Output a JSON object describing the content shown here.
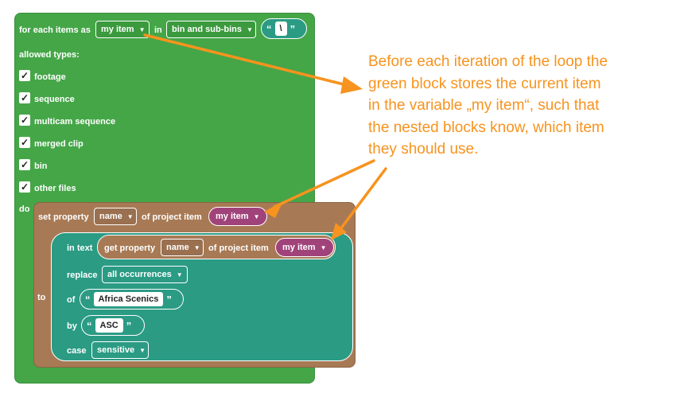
{
  "loop": {
    "label": "for each items as",
    "var": "my item",
    "in_label": "in",
    "scope": "bin and sub-bins",
    "separator": "\\",
    "allowed_label": "allowed types:",
    "types": [
      "footage",
      "sequence",
      "multicam sequence",
      "merged clip",
      "bin",
      "other files"
    ],
    "do_label": "do"
  },
  "set_property": {
    "label": "set property",
    "property": "name",
    "of_label": "of project item",
    "var": "my item",
    "to_label": "to"
  },
  "replace": {
    "in_text_label": "in text",
    "get_label": "get property",
    "get_property": "name",
    "get_of_label": "of project item",
    "get_var": "my item",
    "replace_label": "replace",
    "replace_mode": "all occurrences",
    "of_label": "of",
    "of_value": "Africa Scenics",
    "by_label": "by",
    "by_value": "ASC",
    "case_label": "case",
    "case_mode": "sensitive"
  },
  "annotation": {
    "lines": [
      "Before each iteration of the loop the",
      "green block stores the current item",
      "in the variable „my item“, such that",
      "the nested blocks know, which item",
      "they should use."
    ],
    "color": "#f7931e"
  },
  "colors": {
    "loop_block": "#45a648",
    "set_block": "#a77a55",
    "text_block": "#2b9b84",
    "variable": "#a1437b"
  },
  "glyphs": {
    "quote_open": "“",
    "quote_close": "”",
    "dropdown": "▼",
    "check": "✓"
  }
}
